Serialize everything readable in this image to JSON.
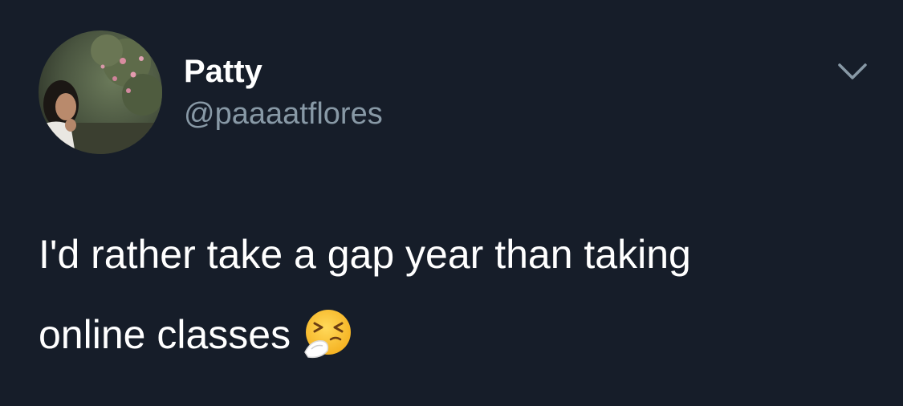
{
  "tweet": {
    "author": {
      "display_name": "Patty",
      "handle": "@paaaatflores"
    },
    "menu_icon": "chevron-down-icon",
    "text_line1": "I'd rather take a gap year than taking",
    "text_line2": "online classes",
    "emoji": "sneezing-face-emoji"
  },
  "colors": {
    "background": "#161d29",
    "text": "#ffffff",
    "secondary_text": "#8899a6"
  }
}
